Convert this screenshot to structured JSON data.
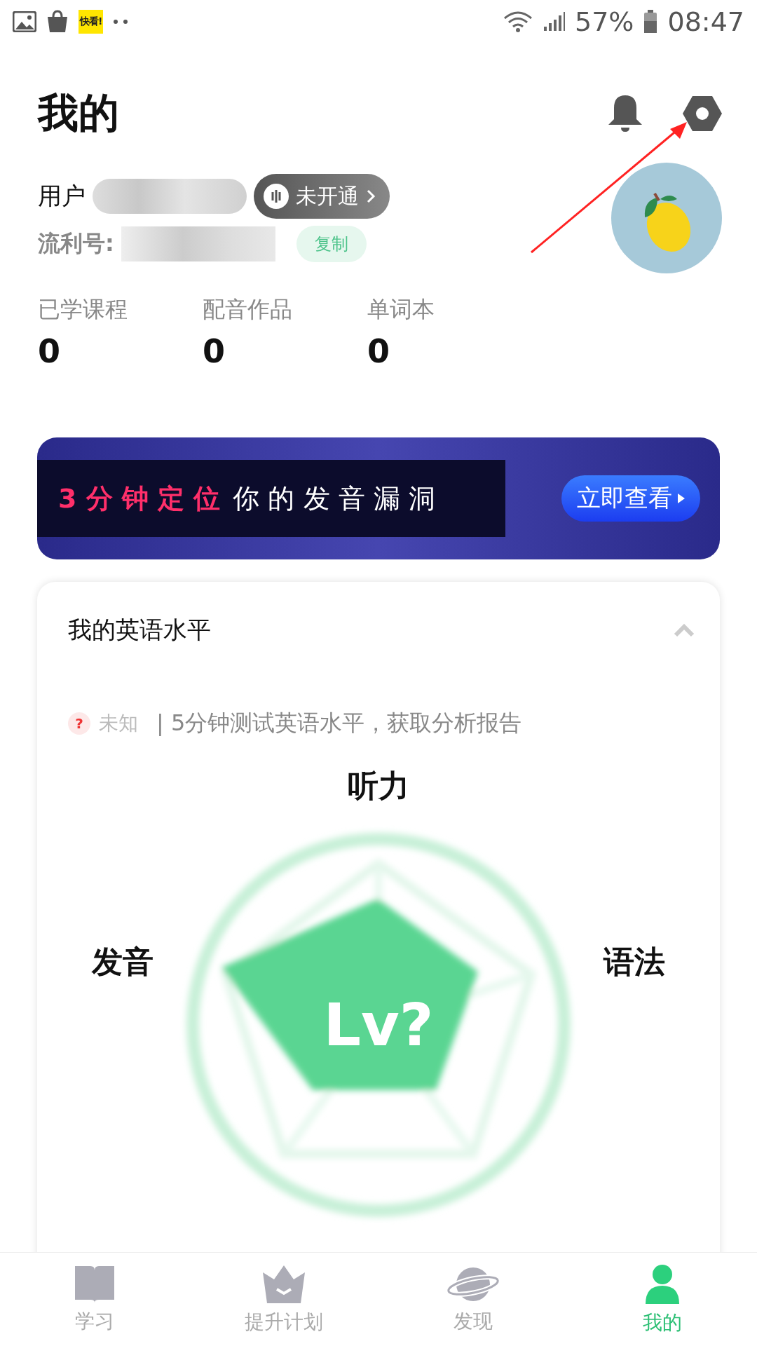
{
  "status_bar": {
    "app_badge": "快看!",
    "battery": "57%",
    "time": "08:47"
  },
  "header": {
    "title": "我的"
  },
  "profile": {
    "name_prefix": "用户",
    "id_label": "流利号:",
    "membership": "未开通",
    "copy_button": "复制"
  },
  "stats": [
    {
      "label": "已学课程",
      "value": "0"
    },
    {
      "label": "配音作品",
      "value": "0"
    },
    {
      "label": "单词本",
      "value": "0"
    }
  ],
  "banner": {
    "highlight": "3 分 钟 定 位",
    "text": "你 的 发 音 漏 洞",
    "button": "立即查看"
  },
  "level_card": {
    "title": "我的英语水平",
    "expanded": true,
    "status_icon": "?",
    "status": "未知",
    "hint": "| 5分钟测试英语水平，获取分析报告",
    "axes": [
      "听力",
      "发音",
      "语法"
    ],
    "center": "Lv?"
  },
  "tabs": [
    {
      "label": "学习",
      "selected": false
    },
    {
      "label": "提升计划",
      "selected": false
    },
    {
      "label": "发现",
      "selected": false
    },
    {
      "label": "我的",
      "selected": true
    }
  ]
}
